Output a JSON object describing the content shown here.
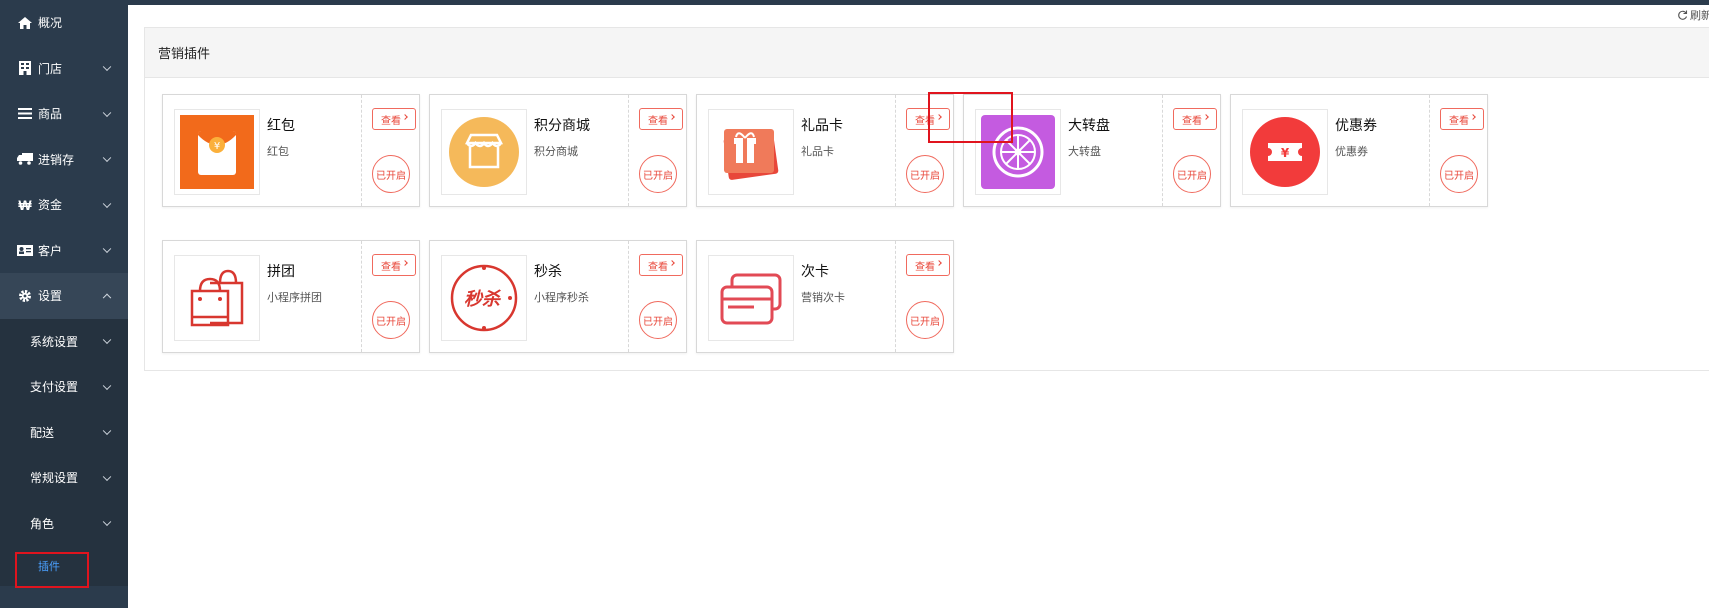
{
  "sidebar": {
    "items": [
      {
        "label": "概况",
        "icon": "home-icon",
        "chevron": "none"
      },
      {
        "label": "门店",
        "icon": "building-icon",
        "chevron": "down"
      },
      {
        "label": "商品",
        "icon": "list-icon",
        "chevron": "down"
      },
      {
        "label": "进销存",
        "icon": "truck-icon",
        "chevron": "down"
      },
      {
        "label": "资金",
        "icon": "won-icon",
        "chevron": "down"
      },
      {
        "label": "客户",
        "icon": "id-card-icon",
        "chevron": "down"
      },
      {
        "label": "设置",
        "icon": "gear-icon",
        "chevron": "up"
      }
    ],
    "sub_items": [
      {
        "label": "系统设置"
      },
      {
        "label": "支付设置"
      },
      {
        "label": "配送"
      },
      {
        "label": "常规设置"
      },
      {
        "label": "角色"
      }
    ],
    "plugin_item": {
      "label": "插件"
    }
  },
  "topbar": {
    "refresh_label": "刷新"
  },
  "panel": {
    "title": "营销插件",
    "cards": [
      {
        "name": "红包",
        "desc": "红包",
        "view_label": "查看",
        "status_label": "已开启",
        "icon": "red-envelope-icon"
      },
      {
        "name": "积分商城",
        "desc": "积分商城",
        "view_label": "查看",
        "status_label": "已开启",
        "icon": "shop-icon"
      },
      {
        "name": "礼品卡",
        "desc": "礼品卡",
        "view_label": "查看",
        "status_label": "已开启",
        "icon": "gift-card-icon"
      },
      {
        "name": "大转盘",
        "desc": "大转盘",
        "view_label": "查看",
        "status_label": "已开启",
        "icon": "wheel-icon"
      },
      {
        "name": "优惠券",
        "desc": "优惠券",
        "view_label": "查看",
        "status_label": "已开启",
        "icon": "coupon-icon"
      },
      {
        "name": "拼团",
        "desc": "小程序拼团",
        "view_label": "查看",
        "status_label": "已开启",
        "icon": "shopping-bag-icon"
      },
      {
        "name": "秒杀",
        "desc": "小程序秒杀",
        "view_label": "查看",
        "status_label": "已开启",
        "icon": "seckill-icon"
      },
      {
        "name": "次卡",
        "desc": "营销次卡",
        "view_label": "查看",
        "status_label": "已开启",
        "icon": "card-icon"
      }
    ]
  },
  "colors": {
    "sidebar": "#2b3b4c",
    "accent_red": "#e8473a",
    "highlight_box": "#e0141e",
    "plugin_link": "#4aa0ff"
  }
}
